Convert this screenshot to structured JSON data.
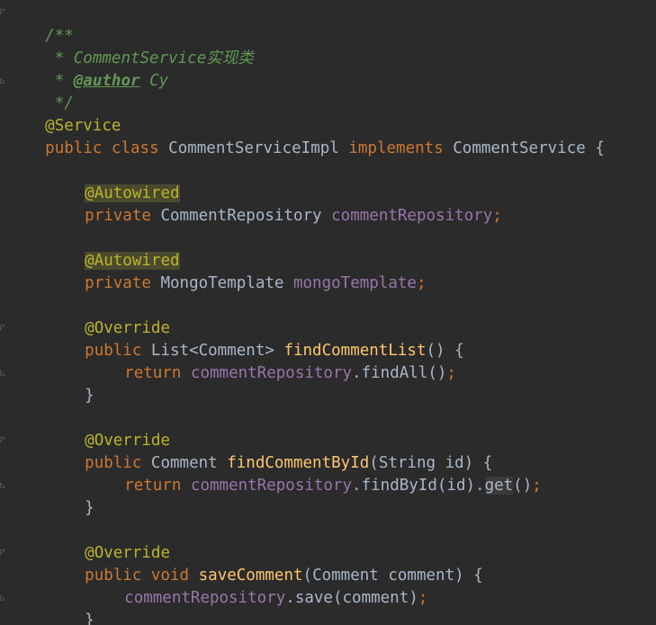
{
  "code": {
    "l1": "/**",
    "l2": " * CommentService实现类",
    "l3_prefix": " * ",
    "l3_tag": "@author",
    "l3_name": " Cy",
    "l4": " */",
    "l5": "@Service",
    "l6_kw1": "public",
    "l6_kw2": "class",
    "l6_name": "CommentServiceImpl",
    "l6_kw3": "implements",
    "l6_iface": "CommentService",
    "l6_brace": "{",
    "autowired": "@Autowired",
    "private_kw": "private",
    "repo_type": "CommentRepository",
    "repo_field": "commentRepository",
    "semi": ";",
    "mongo_type": "MongoTemplate",
    "mongo_field": "mongoTemplate",
    "override": "@Override",
    "public_kw": "public",
    "list_type": "List<Comment>",
    "m1_name": "findCommentList",
    "m1_params": "()",
    "open_brace": "{",
    "return_kw": "return",
    "dot": ".",
    "find_all": "findAll()",
    "close_brace": "}",
    "comment_type": "Comment",
    "m2_name": "findCommentById",
    "m2_params": "(String id)",
    "find_by_id": "findById(id).",
    "get_call": "get",
    "parens": "()",
    "void_kw": "void",
    "m3_name": "saveComment",
    "m3_params": "(Comment comment)",
    "save_call": "save(comment)"
  },
  "colors": {
    "background": "#2b2b2b",
    "comment": "#629755",
    "annotation": "#bbb529",
    "keyword": "#cc7832",
    "field": "#9876aa",
    "method": "#ffc66d",
    "text": "#a9b7c6"
  }
}
